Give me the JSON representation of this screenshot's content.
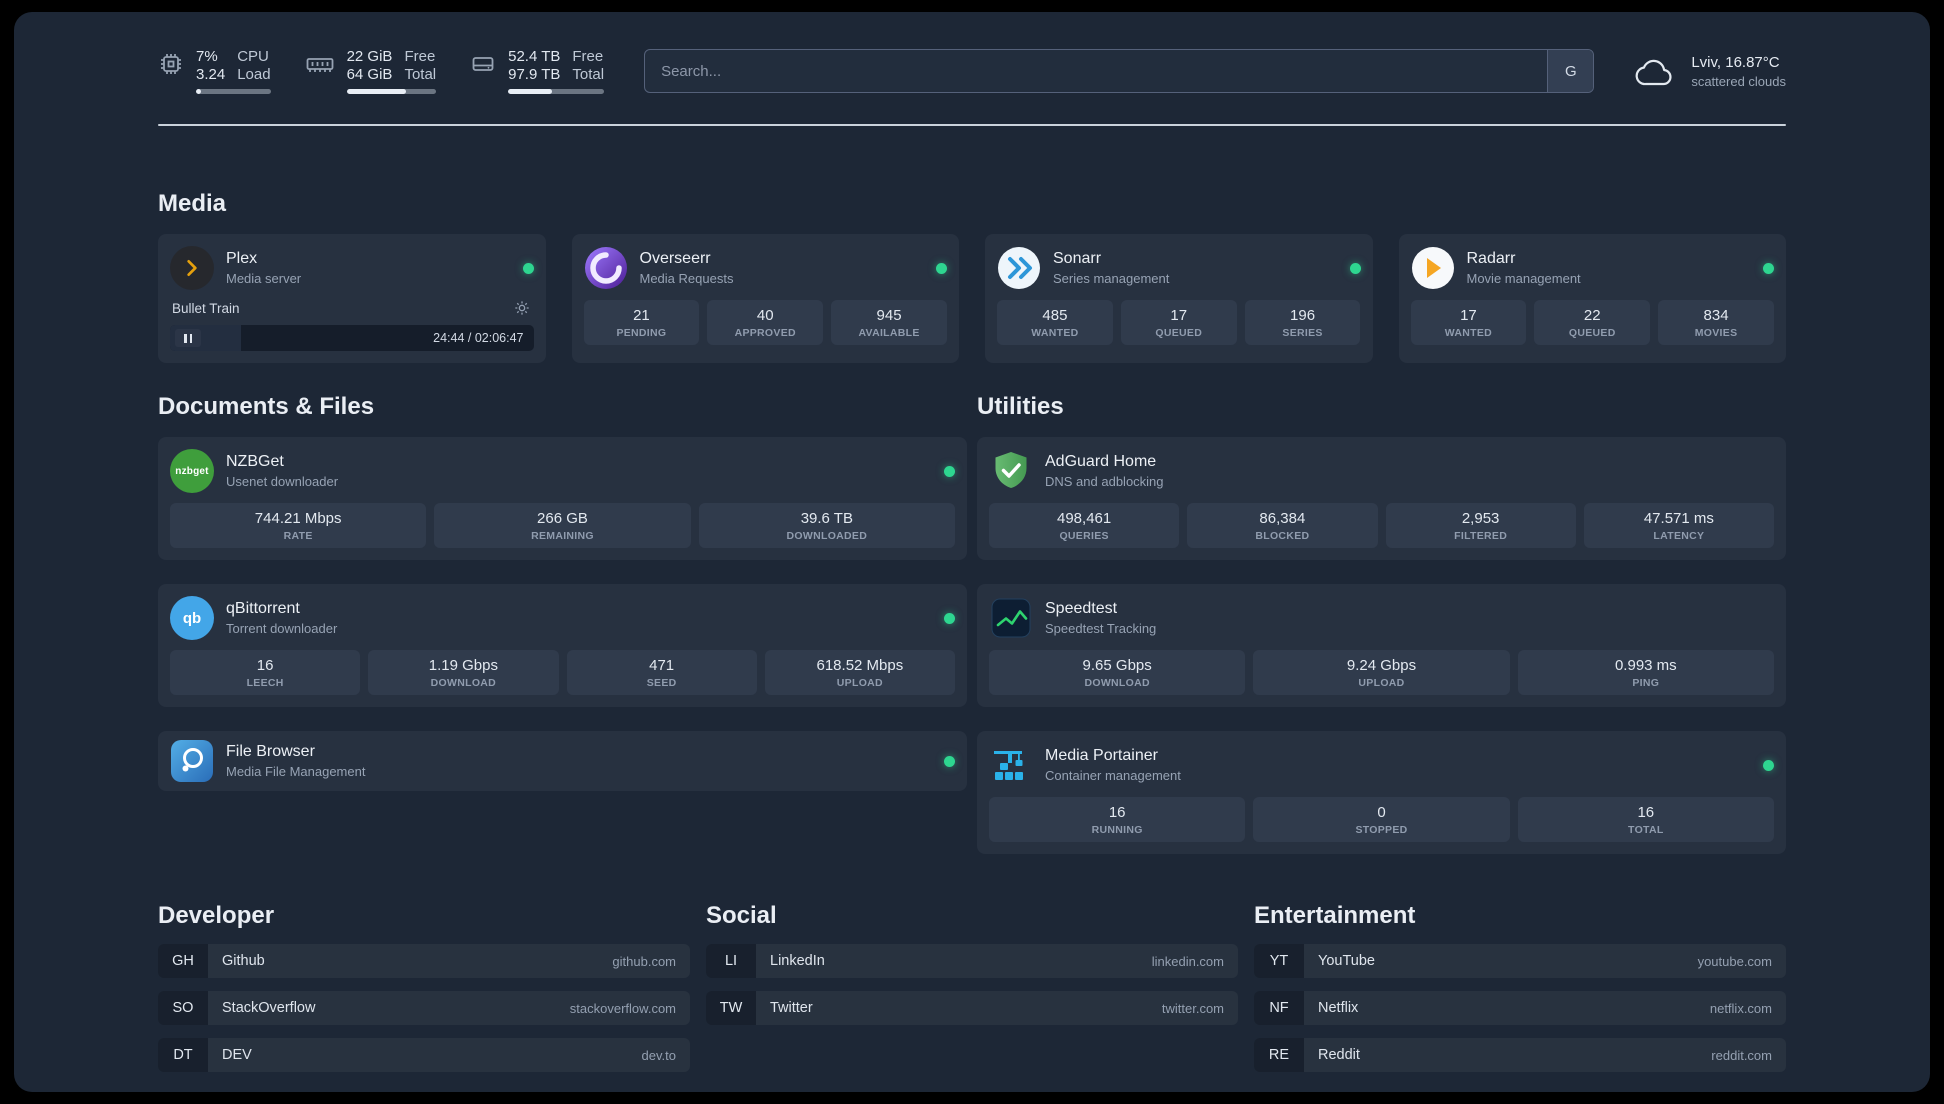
{
  "topbar": {
    "resources": [
      {
        "icon": "cpu-icon",
        "col1": [
          "7%",
          "3.24"
        ],
        "col2": [
          "CPU",
          "Load"
        ],
        "bar_pct": 7
      },
      {
        "icon": "memory-icon",
        "col1": [
          "22 GiB",
          "64 GiB"
        ],
        "col2": [
          "Free",
          "Total"
        ],
        "bar_pct": 66
      },
      {
        "icon": "disk-icon",
        "col1": [
          "52.4 TB",
          "97.9 TB"
        ],
        "col2": [
          "Free",
          "Total"
        ],
        "bar_pct": 46
      }
    ],
    "search": {
      "placeholder": "Search...",
      "provider_button": "G"
    },
    "weather": {
      "location": "Lviv, 16.87°C",
      "condition": "scattered clouds"
    }
  },
  "sections": {
    "media": {
      "title": "Media",
      "cards": [
        {
          "name": "Plex",
          "subtitle": "Media server",
          "status": "online",
          "player": {
            "track": "Bullet Train",
            "time_display": "24:44 / 02:06:47",
            "progress_pct": 19.5
          }
        },
        {
          "name": "Overseerr",
          "subtitle": "Media Requests",
          "status": "online",
          "stats": [
            {
              "value": "21",
              "label": "PENDING"
            },
            {
              "value": "40",
              "label": "APPROVED"
            },
            {
              "value": "945",
              "label": "AVAILABLE"
            }
          ]
        },
        {
          "name": "Sonarr",
          "subtitle": "Series management",
          "status": "online",
          "stats": [
            {
              "value": "485",
              "label": "WANTED"
            },
            {
              "value": "17",
              "label": "QUEUED"
            },
            {
              "value": "196",
              "label": "SERIES"
            }
          ]
        },
        {
          "name": "Radarr",
          "subtitle": "Movie management",
          "status": "online",
          "stats": [
            {
              "value": "17",
              "label": "WANTED"
            },
            {
              "value": "22",
              "label": "QUEUED"
            },
            {
              "value": "834",
              "label": "MOVIES"
            }
          ]
        }
      ]
    },
    "documents": {
      "title": "Documents & Files",
      "cards": [
        {
          "name": "NZBGet",
          "subtitle": "Usenet downloader",
          "status": "online",
          "stats": [
            {
              "value": "744.21 Mbps",
              "label": "RATE"
            },
            {
              "value": "266 GB",
              "label": "REMAINING"
            },
            {
              "value": "39.6 TB",
              "label": "DOWNLOADED"
            }
          ]
        },
        {
          "name": "qBittorrent",
          "subtitle": "Torrent downloader",
          "status": "online",
          "stats": [
            {
              "value": "16",
              "label": "LEECH"
            },
            {
              "value": "1.19 Gbps",
              "label": "DOWNLOAD"
            },
            {
              "value": "471",
              "label": "SEED"
            },
            {
              "value": "618.52 Mbps",
              "label": "UPLOAD"
            }
          ]
        },
        {
          "name": "File Browser",
          "subtitle": "Media File Management",
          "status": "online",
          "stats": []
        }
      ]
    },
    "utilities": {
      "title": "Utilities",
      "cards": [
        {
          "name": "AdGuard Home",
          "subtitle": "DNS and adblocking",
          "stats": [
            {
              "value": "498,461",
              "label": "QUERIES"
            },
            {
              "value": "86,384",
              "label": "BLOCKED"
            },
            {
              "value": "2,953",
              "label": "FILTERED"
            },
            {
              "value": "47.571 ms",
              "label": "LATENCY"
            }
          ]
        },
        {
          "name": "Speedtest",
          "subtitle": "Speedtest Tracking",
          "stats": [
            {
              "value": "9.65 Gbps",
              "label": "DOWNLOAD"
            },
            {
              "value": "9.24 Gbps",
              "label": "UPLOAD"
            },
            {
              "value": "0.993 ms",
              "label": "PING"
            }
          ]
        },
        {
          "name": "Media Portainer",
          "subtitle": "Container management",
          "status": "online",
          "stats": [
            {
              "value": "16",
              "label": "RUNNING"
            },
            {
              "value": "0",
              "label": "STOPPED"
            },
            {
              "value": "16",
              "label": "TOTAL"
            }
          ]
        }
      ]
    }
  },
  "bookmarks": [
    {
      "title": "Developer",
      "items": [
        {
          "abbr": "GH",
          "name": "Github",
          "domain": "github.com"
        },
        {
          "abbr": "SO",
          "name": "StackOverflow",
          "domain": "stackoverflow.com"
        },
        {
          "abbr": "DT",
          "name": "DEV",
          "domain": "dev.to"
        }
      ]
    },
    {
      "title": "Social",
      "items": [
        {
          "abbr": "LI",
          "name": "LinkedIn",
          "domain": "linkedin.com"
        },
        {
          "abbr": "TW",
          "name": "Twitter",
          "domain": "twitter.com"
        }
      ]
    },
    {
      "title": "Entertainment",
      "items": [
        {
          "abbr": "YT",
          "name": "YouTube",
          "domain": "youtube.com"
        },
        {
          "abbr": "NF",
          "name": "Netflix",
          "domain": "netflix.com"
        },
        {
          "abbr": "RE",
          "name": "Reddit",
          "domain": "reddit.com"
        }
      ]
    }
  ],
  "icon_texts": {
    "nzbget": "nzbget",
    "qbittorrent": "qb"
  },
  "colors": {
    "background": "#1d2736",
    "card": "#273140",
    "tile": "#303b4c",
    "status_online": "#2ed690",
    "plex_accent": "#e5a00d",
    "adguard_green": "#5cae66",
    "portainer_blue": "#2ab2e9",
    "speedtest_green": "#2ed36f"
  }
}
